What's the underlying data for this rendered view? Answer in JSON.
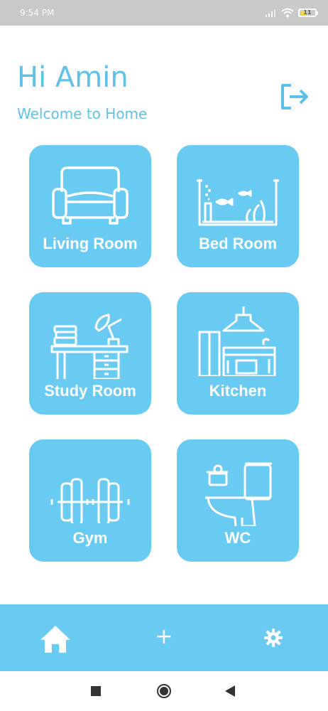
{
  "status_bar": {
    "time": "9:54 PM",
    "battery_level": "11",
    "icons": [
      "signal-icon",
      "wifi-icon",
      "battery-icon"
    ]
  },
  "header": {
    "greeting": "Hi Amin",
    "subtitle": "Welcome to Home",
    "logout_icon": "logout-icon"
  },
  "rooms": [
    {
      "label": "Living Room",
      "icon": "sofa-icon"
    },
    {
      "label": "Bed Room",
      "icon": "aquarium-icon"
    },
    {
      "label": "Study Room",
      "icon": "desk-icon"
    },
    {
      "label": "Kitchen",
      "icon": "kitchen-icon"
    },
    {
      "label": "Gym",
      "icon": "dumbbell-icon"
    },
    {
      "label": "WC",
      "icon": "toilet-icon"
    }
  ],
  "bottom_nav": {
    "items": [
      "home-icon",
      "add-icon",
      "gear-icon"
    ],
    "add_label": "+"
  },
  "android_nav": [
    "recents-icon",
    "home-circle-icon",
    "back-icon"
  ],
  "colors": {
    "accent": "#69caf2",
    "text_accent": "#5fc1ea",
    "status_bar": "#c9c9c9",
    "background": "#ffffff"
  }
}
